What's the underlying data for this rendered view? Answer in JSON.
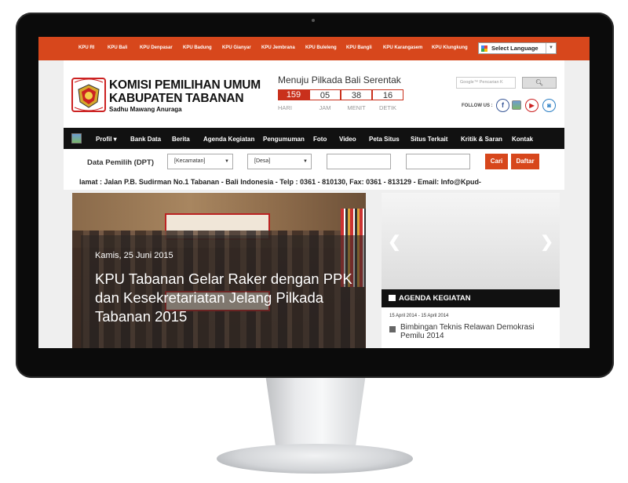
{
  "topbar": {
    "links": [
      "KPU RI",
      "KPU Bali",
      "KPU Denpasar",
      "KPU Badung",
      "KPU Gianyar",
      "KPU Jembrana",
      "KPU Buleleng",
      "KPU Bangli",
      "KPU Karangasem",
      "KPU Klungkung"
    ],
    "language": "Select Language"
  },
  "header": {
    "title_line1": "KOMISI PEMILIHAN UMUM",
    "title_line2": "KABUPATEN TABANAN",
    "tagline": "Sadhu Mawang Anuraga",
    "logo_text_top": "KOMISI",
    "logo_text_bottom": "PEMILIHAN UMUM",
    "countdown": {
      "title": "Menuju Pilkada Bali Serentak",
      "values": [
        "159",
        "05",
        "38",
        "16"
      ],
      "labels": [
        "HARI",
        "JAM",
        "MENIT",
        "DETIK"
      ]
    },
    "search_placeholder": "Google™ Pencarian K",
    "follow_label": "FOLLOW US :",
    "social_icons": [
      "facebook-icon",
      "twitter-icon",
      "youtube-icon",
      "instagram-icon"
    ]
  },
  "nav": {
    "items": [
      "Profil ▾",
      "Bank Data",
      "Berita",
      "Agenda Kegiatan",
      "Pengumuman",
      "Foto",
      "Video",
      "Peta Situs",
      "Situs Terkait",
      "Kritik & Saran",
      "Kontak"
    ]
  },
  "dpt": {
    "label": "Data Pemilih (DPT)",
    "kecamatan": "[Kecamatan]",
    "desa": "[Desa]",
    "cari": "Cari",
    "daftar": "Daftar"
  },
  "marquee": "lamat : Jalan P.B. Sudirman No.1 Tabanan - Bali Indonesia - Telp : 0361 - 810130, Fax: 0361 - 813129 - Email: Info@Kpud-",
  "slider": {
    "date": "Kamis, 25 Juni 2015",
    "title": "KPU Tabanan Gelar Raker dengan PPK dan Kesekretariatan Jelang Pilkada Tabanan 2015"
  },
  "agenda": {
    "heading": "AGENDA KEGIATAN",
    "date": "15 April 2014 - 15 April 2014",
    "title": "Bimbingan Teknis Relawan Demokrasi Pemilu 2014"
  },
  "colors": {
    "accent": "#d7471c",
    "nav": "#111111",
    "countdown": "#c9301c"
  }
}
